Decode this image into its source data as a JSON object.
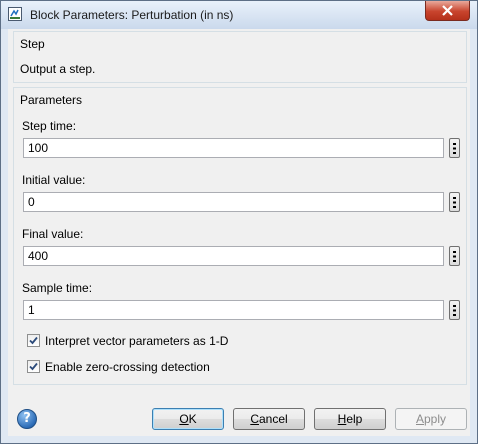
{
  "window": {
    "title": "Block Parameters: Perturbation (in ns)"
  },
  "step_section": {
    "title": "Step",
    "description": "Output a step."
  },
  "params_section": {
    "title": "Parameters",
    "fields": [
      {
        "label": "Step time:",
        "value": "100"
      },
      {
        "label": "Initial value:",
        "value": "0"
      },
      {
        "label": "Final value:",
        "value": "400"
      },
      {
        "label": "Sample time:",
        "value": "1"
      }
    ],
    "checkboxes": [
      {
        "label": "Interpret vector parameters as 1-D",
        "checked": true
      },
      {
        "label": "Enable zero-crossing detection",
        "checked": true
      }
    ]
  },
  "buttons": {
    "ok": {
      "pre": "",
      "mnemonic": "O",
      "post": "K"
    },
    "cancel": {
      "pre": "",
      "mnemonic": "C",
      "post": "ancel"
    },
    "help": {
      "pre": "",
      "mnemonic": "H",
      "post": "elp"
    },
    "apply": {
      "pre": "",
      "mnemonic": "A",
      "post": "pply"
    }
  },
  "help_icon": {
    "glyph": "?"
  },
  "icons": [
    "app-icon",
    "close-icon",
    "more-options-icon",
    "checkmark-icon",
    "help-icon"
  ]
}
